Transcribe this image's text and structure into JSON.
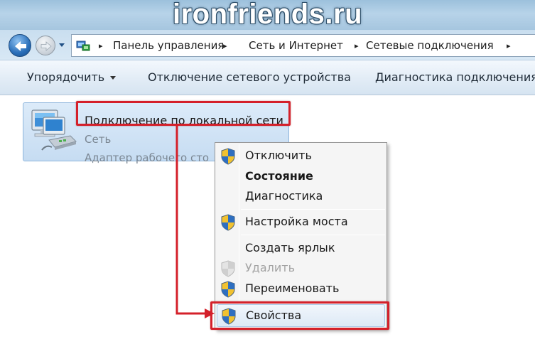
{
  "watermark": "ironfriends.ru",
  "address": {
    "crumbs": [
      "Панель управления",
      "Сеть и Интернет",
      "Сетевые подключения"
    ],
    "separator": "▸"
  },
  "toolbar": {
    "organize": "Упорядочить",
    "disable_device": "Отключение сетевого устройства",
    "diagnose": "Диагностика подключения"
  },
  "connection": {
    "title": "Подключение по локальной сети",
    "network": "Сеть",
    "adapter": "Адаптер рабочего сто"
  },
  "context_menu": {
    "items": [
      {
        "label": "Отключить",
        "shield": true,
        "style": "normal"
      },
      {
        "label": "Состояние",
        "shield": false,
        "style": "bold"
      },
      {
        "label": "Диагностика",
        "shield": false,
        "style": "normal"
      },
      {
        "label": "Настройка моста",
        "shield": true,
        "style": "normal"
      },
      {
        "label": "Создать ярлык",
        "shield": false,
        "style": "normal"
      },
      {
        "label": "Удалить",
        "shield": true,
        "style": "disabled"
      },
      {
        "label": "Переименовать",
        "shield": true,
        "style": "normal"
      },
      {
        "label": "Свойства",
        "shield": true,
        "style": "highlighted"
      }
    ]
  },
  "colors": {
    "highlight_frame": "#d4202a",
    "selection": "#c6dcf2"
  }
}
